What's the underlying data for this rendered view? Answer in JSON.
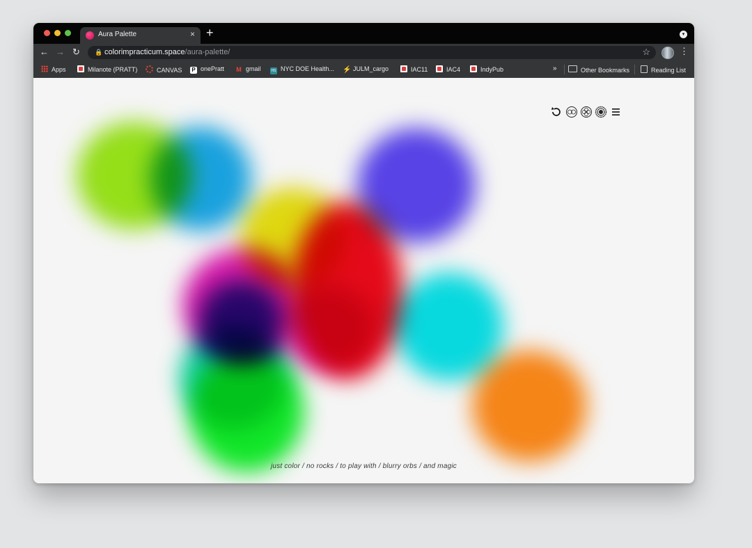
{
  "browser": {
    "tab_title": "Aura Palette",
    "tab_close": "×",
    "new_tab": "+",
    "url_host": "colorimpracticum.space",
    "url_path": "/aura-palette/"
  },
  "bookmarks": {
    "items": [
      {
        "label": "Apps",
        "icon": "apps-grid-icon"
      },
      {
        "label": "Milanote (PRATT)",
        "icon": "milanote-icon"
      },
      {
        "label": "CANVAS",
        "icon": "canvas-icon"
      },
      {
        "label": "onePratt",
        "icon": "onepratt-icon"
      },
      {
        "label": "gmail",
        "icon": "gmail-icon"
      },
      {
        "label": "NYC DOE Health...",
        "icon": "nyc-doe-icon"
      },
      {
        "label": "JULM_cargo",
        "icon": "cargo-icon"
      },
      {
        "label": "IAC11",
        "icon": "milanote-icon"
      },
      {
        "label": "IAC4",
        "icon": "milanote-icon"
      },
      {
        "label": "IndyPub",
        "icon": "milanote-icon"
      }
    ],
    "more": "»",
    "other_bookmarks": "Other Bookmarks",
    "reading_list": "Reading List"
  },
  "page": {
    "tagline": "just color / no rocks / to play with / blurry orbs / and magic",
    "controls": [
      "reset-icon",
      "palette-ring-icon",
      "palette-flower-icon",
      "palette-sun-icon",
      "hamburger-menu-icon"
    ],
    "orbs": [
      {
        "name": "lime-orb",
        "color": "#9be81a"
      },
      {
        "name": "sky-blue-orb",
        "color": "#1aa8e8"
      },
      {
        "name": "violet-orb",
        "color": "#5b45f0"
      },
      {
        "name": "yellow-orb",
        "color": "#e8e010"
      },
      {
        "name": "red-orb",
        "color": "#ee0a1a"
      },
      {
        "name": "magenta-orb",
        "color": "#e01ab0"
      },
      {
        "name": "navy-orb",
        "color": "#2f3aa0"
      },
      {
        "name": "teal-orb",
        "color": "#10d8a8"
      },
      {
        "name": "green-orb",
        "color": "#12f02a"
      },
      {
        "name": "cyan-orb",
        "color": "#08e2e8"
      },
      {
        "name": "orange-orb",
        "color": "#ff8a18"
      }
    ]
  }
}
